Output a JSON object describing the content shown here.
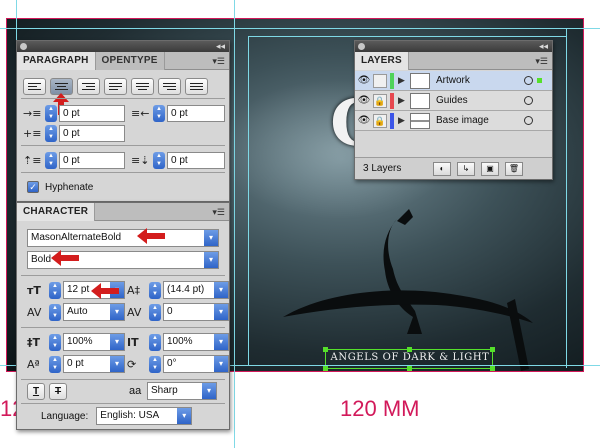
{
  "canvas": {
    "artwork_title": "Goth",
    "subtitle": "ANGELS OF DARK & LIGHT",
    "dimension_label": "120 MM",
    "dimension_label_cut": "12",
    "colors": {
      "guide": "#7fd9e6",
      "bleed": "#d2195a",
      "selection": "#55e02b"
    }
  },
  "paragraph_panel": {
    "tabs": [
      {
        "label": "PARAGRAPH",
        "active": true
      },
      {
        "label": "OPENTYPE",
        "active": false
      }
    ],
    "alignment_selected": "align-center",
    "left_indent": "0 pt",
    "right_indent": "0 pt",
    "first_line_indent": "0 pt",
    "space_before": "0 pt",
    "space_after": "0 pt",
    "hyphenate_label": "Hyphenate",
    "hyphenate_checked": true
  },
  "character_panel": {
    "title": "CHARACTER",
    "font_family": "MasonAlternateBold",
    "font_style": "Bold",
    "font_size": "12 pt",
    "leading": "(14.4 pt)",
    "kerning": "Auto",
    "tracking": "0",
    "vertical_scale": "100%",
    "horizontal_scale": "100%",
    "baseline_shift": "0 pt",
    "rotation": "0°",
    "antialias_label": "aa",
    "antialias": "Sharp",
    "language_label": "Language:",
    "language": "English: USA"
  },
  "layers_panel": {
    "title": "LAYERS",
    "layers": [
      {
        "name": "Artwork",
        "color": "#4fd35a",
        "selected": true
      },
      {
        "name": "Guides",
        "color": "#e6474f",
        "selected": false
      },
      {
        "name": "Base image",
        "color": "#3b55e8",
        "selected": false
      }
    ],
    "count_label": "3 Layers"
  }
}
